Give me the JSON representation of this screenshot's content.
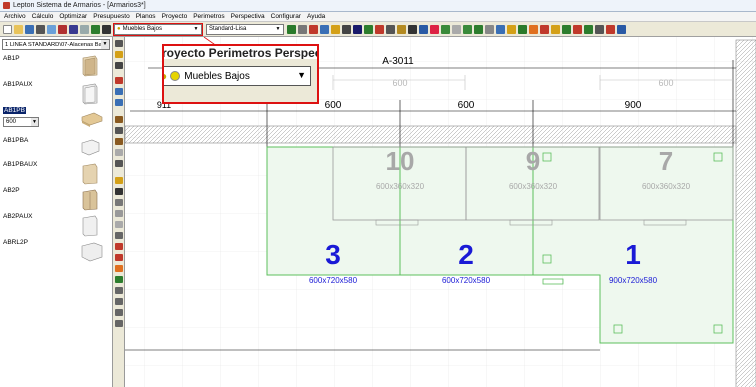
{
  "window": {
    "title": "Lepton Sistema de Armarios - [Armarios3*]"
  },
  "menu": [
    "Archivo",
    "Cálculo",
    "Optimizar",
    "Presupuesto",
    "Planos",
    "Proyecto",
    "Perimetros",
    "Perspectiva",
    "Configurar",
    "Ayuda"
  ],
  "toolbar": {
    "layer_combo": "Muebles Bajos",
    "style_combo": "Standard-Lisa"
  },
  "zoom_callout": {
    "label": "Muebles Bajos",
    "behind_text": "Proyecto  Perimetros  Perspect"
  },
  "library": {
    "selector": "1 LINEA STANDARD\\07-Alacenas Ba",
    "size_value": "600",
    "items": [
      {
        "name": "AB1P"
      },
      {
        "name": "AB1PAUX"
      },
      {
        "name": "AB1PB",
        "selected": true
      },
      {
        "name": "AB1PBA"
      },
      {
        "name": "AB1PBAUX"
      },
      {
        "name": "AB2P"
      },
      {
        "name": "AB2PAUX"
      },
      {
        "name": "ABRL2P"
      }
    ]
  },
  "plan": {
    "wall_label": "A-3011",
    "top_dims": [
      "911",
      "600",
      "600",
      "900"
    ],
    "upper_dims": [
      "600",
      "600"
    ],
    "modules": [
      {
        "number": "3",
        "size": "600x720x580"
      },
      {
        "number": "2",
        "size": "600x720x580"
      },
      {
        "number": "1",
        "size": "900x720x580"
      }
    ],
    "wall_modules": [
      {
        "number": "10",
        "size": "600x360x320"
      },
      {
        "number": "9",
        "size": "600x360x320"
      },
      {
        "number": "7",
        "size": "600x360x320"
      }
    ]
  },
  "colors": {
    "module_stroke": "#5cbf5c",
    "module_fill": "#eaf7ea",
    "module_number": "#1a1ad6",
    "wall_number": "#a6a6a6",
    "highlight": "#dd1111"
  }
}
